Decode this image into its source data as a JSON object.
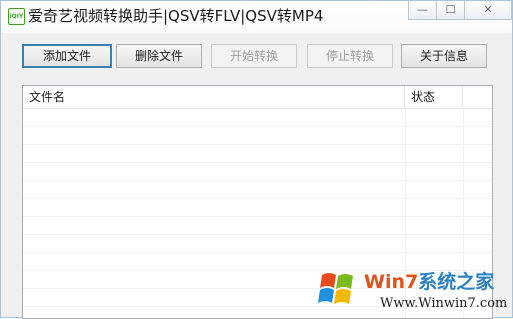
{
  "window": {
    "title": "爱奇艺视频转换助手|QSV转FLV|QSV转MP4",
    "app_icon_text": "iQIY"
  },
  "caption_buttons": {
    "minimize": "—",
    "maximize": "☐",
    "close": "✕"
  },
  "toolbar": {
    "add_file": "添加文件",
    "delete_file": "删除文件",
    "start_convert": "开始转换",
    "stop_convert": "停止转换",
    "about": "关于信息"
  },
  "file_list": {
    "columns": [
      "文件名",
      "状态"
    ],
    "rows": []
  },
  "watermark": {
    "brand_a": "Win7",
    "brand_b": "系统之家",
    "url": "Www.Winwin7.com"
  },
  "colors": {
    "primary_border": "#3c7fb1",
    "watermark_orange": "#e0531a",
    "watermark_blue": "#2a7fc5"
  }
}
